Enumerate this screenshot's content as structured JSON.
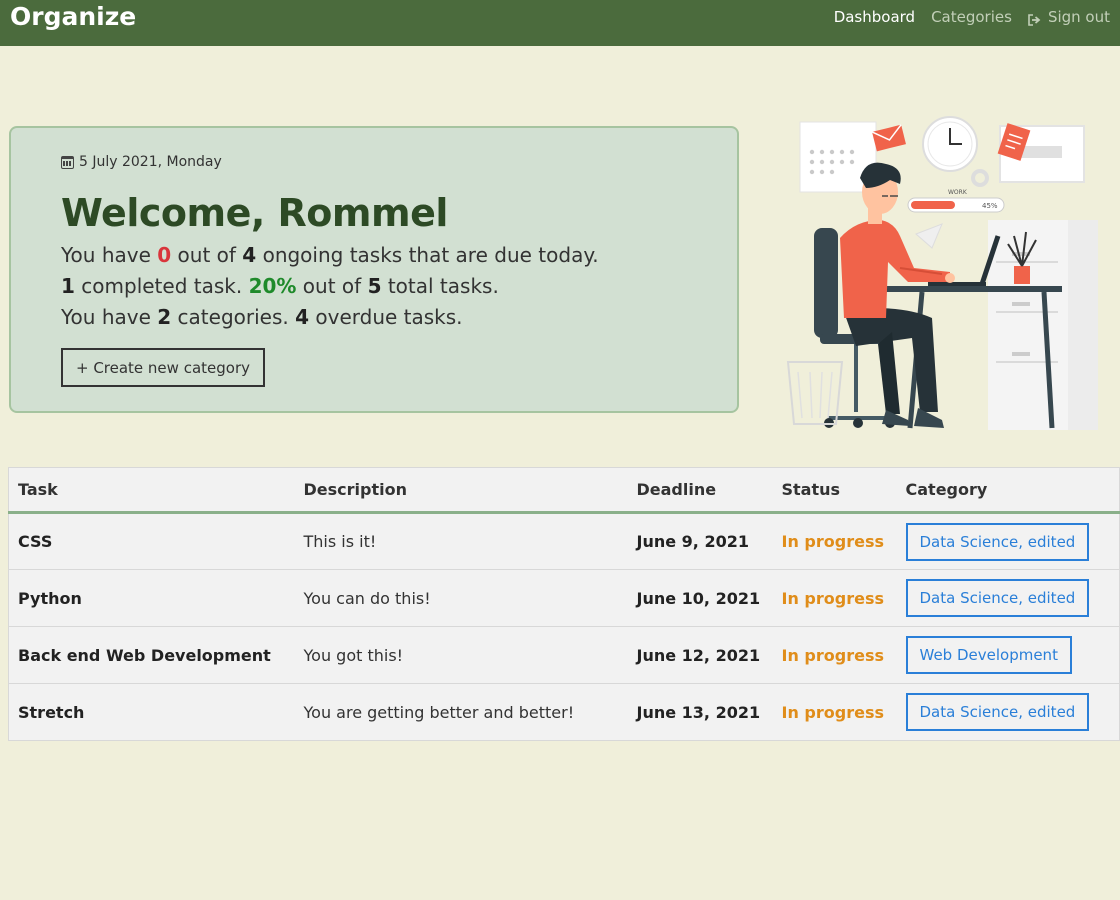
{
  "nav": {
    "brand": "Organize",
    "links": [
      {
        "label": "Dashboard",
        "active": true
      },
      {
        "label": "Categories",
        "active": false
      },
      {
        "label": "Sign out",
        "active": false
      }
    ]
  },
  "welcome": {
    "date": "5 July 2021, Monday",
    "title": "Welcome, Rommel",
    "line1": {
      "pre": "You have ",
      "due_today": "0",
      "mid": " out of ",
      "ongoing": "4",
      "post": " ongoing tasks that are due today."
    },
    "line2": {
      "completed": "1",
      "mid1": " completed task. ",
      "percent": "20%",
      "mid2": " out of ",
      "total": "5",
      "post": " total tasks."
    },
    "line3": {
      "pre": "You have ",
      "categories": "2",
      "mid": " categories. ",
      "overdue": "4",
      "post": " overdue tasks."
    },
    "create_button": "+ Create new category"
  },
  "illustration": {
    "work_label": "WORK",
    "work_progress": "45%"
  },
  "table": {
    "headers": [
      "Task",
      "Description",
      "Deadline",
      "Status",
      "Category"
    ],
    "rows": [
      {
        "task": "CSS",
        "description": "This is it!",
        "deadline": "June 9, 2021",
        "status": "In progress",
        "category": "Data Science, edited"
      },
      {
        "task": "Python",
        "description": "You can do this!",
        "deadline": "June 10, 2021",
        "status": "In progress",
        "category": "Data Science, edited"
      },
      {
        "task": "Back end Web Development",
        "description": "You got this!",
        "deadline": "June 12, 2021",
        "status": "In progress",
        "category": "Web Development"
      },
      {
        "task": "Stretch",
        "description": "You are getting better and better!",
        "deadline": "June 13, 2021",
        "status": "In progress",
        "category": "Data Science, edited"
      }
    ]
  },
  "colors": {
    "navbar": "#4b6b3d",
    "background": "#f0efda",
    "card": "#d2e0d2",
    "status": "#e08d1a",
    "badge": "#2a7fd8"
  }
}
